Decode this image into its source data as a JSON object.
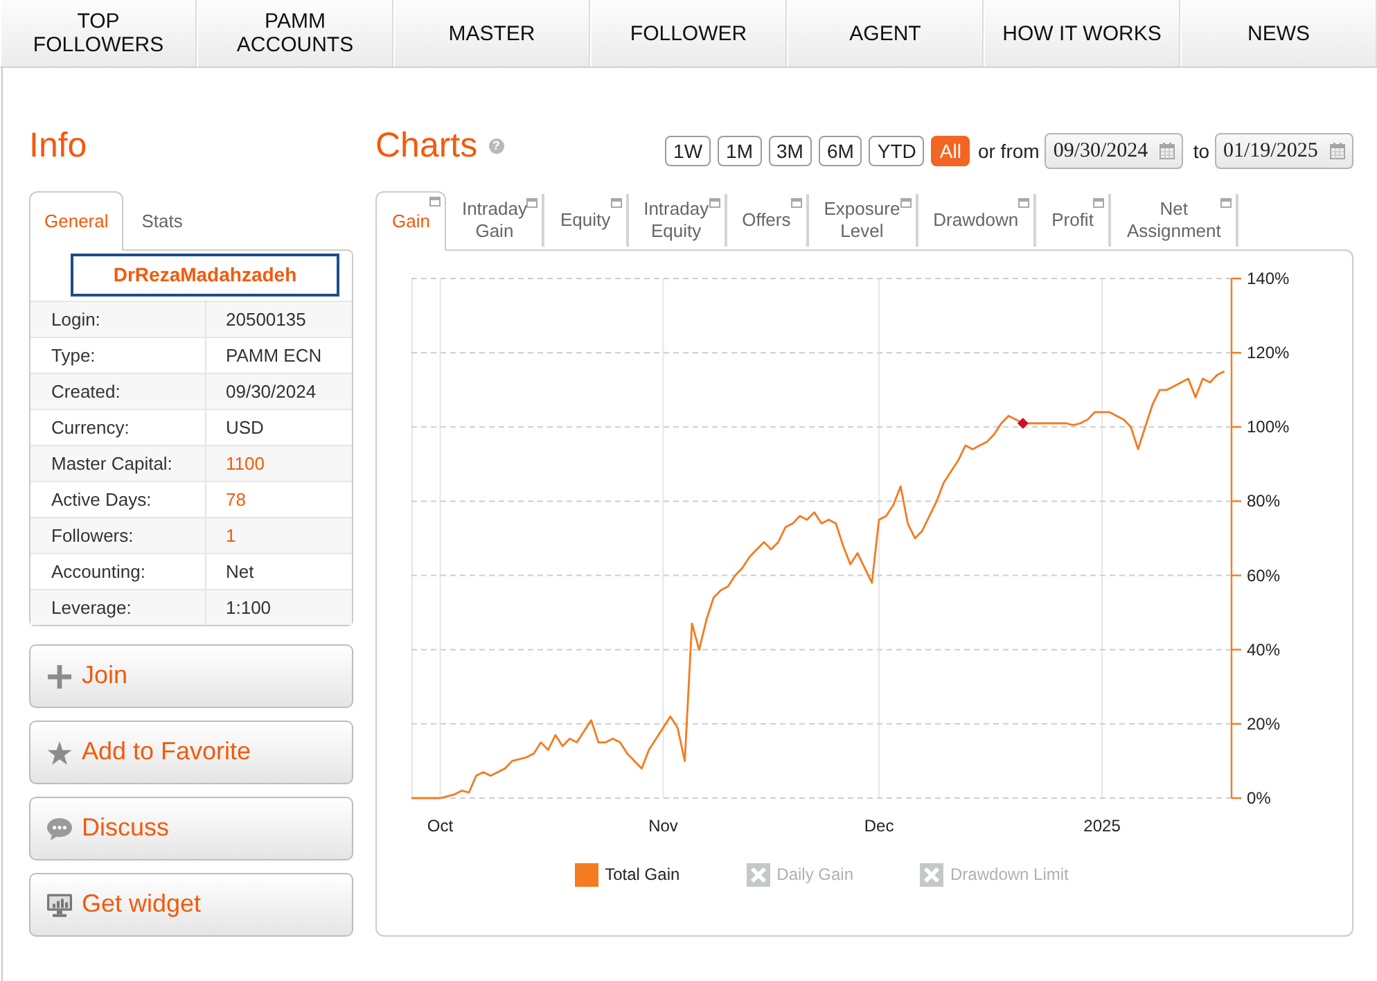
{
  "nav": [
    "TOP FOLLOWERS",
    "PAMM ACCOUNTS",
    "MASTER",
    "FOLLOWER",
    "AGENT",
    "HOW IT WORKS",
    "NEWS"
  ],
  "info": {
    "title": "Info",
    "tabs": [
      {
        "label": "General",
        "selected": true
      },
      {
        "label": "Stats",
        "selected": false
      }
    ],
    "account_name": "DrRezaMadahzadeh",
    "rows": [
      {
        "label": "Login:",
        "value": "20500135",
        "highlighted": false
      },
      {
        "label": "Type:",
        "value": "PAMM ECN",
        "highlighted": false
      },
      {
        "label": "Created:",
        "value": "09/30/2024",
        "highlighted": false
      },
      {
        "label": "Currency:",
        "value": "USD",
        "highlighted": false
      },
      {
        "label": "Master Capital:",
        "value": "1100",
        "highlighted": true
      },
      {
        "label": "Active Days:",
        "value": "78",
        "highlighted": true
      },
      {
        "label": "Followers:",
        "value": "1",
        "highlighted": true
      },
      {
        "label": "Accounting:",
        "value": "Net",
        "highlighted": false
      },
      {
        "label": "Leverage:",
        "value": "1:100",
        "highlighted": false
      }
    ],
    "actions": [
      {
        "kind": "plus",
        "label": "Join"
      },
      {
        "kind": "star",
        "label": "Add to Favorite"
      },
      {
        "kind": "chat",
        "label": "Discuss"
      },
      {
        "kind": "monitor",
        "label": "Get widget"
      }
    ]
  },
  "charts": {
    "title": "Charts",
    "help": "?",
    "ranges": [
      {
        "label": "1W",
        "selected": false
      },
      {
        "label": "1M",
        "selected": false
      },
      {
        "label": "3M",
        "selected": false
      },
      {
        "label": "6M",
        "selected": false
      },
      {
        "label": "YTD",
        "selected": false
      },
      {
        "label": "All",
        "selected": true
      }
    ],
    "from_label": "or from",
    "date_from": {
      "value": "09/30/2024"
    },
    "to_label": "to",
    "date_to": {
      "value": "01/19/2025"
    },
    "tabs": [
      {
        "label": "Gain",
        "selected": true
      },
      {
        "label": "Intraday Gain",
        "selected": false
      },
      {
        "label": "Equity",
        "selected": false
      },
      {
        "label": "Intraday Equity",
        "selected": false
      },
      {
        "label": "Offers",
        "selected": false
      },
      {
        "label": "Exposure Level",
        "selected": false
      },
      {
        "label": "Drawdown",
        "selected": false
      },
      {
        "label": "Profit",
        "selected": false
      },
      {
        "label": "Net Assignment",
        "selected": false
      }
    ],
    "chart_data": {
      "type": "line",
      "grid": true,
      "ylim": [
        0,
        140
      ],
      "yticks": [
        {
          "value": 0,
          "label": "0%"
        },
        {
          "value": 20,
          "label": "20%"
        },
        {
          "value": 40,
          "label": "40%"
        },
        {
          "value": 60,
          "label": "60%"
        },
        {
          "value": 80,
          "label": "80%"
        },
        {
          "value": 100,
          "label": "100%"
        },
        {
          "value": 120,
          "label": "120%"
        },
        {
          "value": 140,
          "label": "140%"
        }
      ],
      "categories": [
        null,
        null,
        null,
        null,
        "Oct",
        null,
        null,
        null,
        null,
        null,
        null,
        null,
        null,
        null,
        null,
        null,
        null,
        null,
        null,
        null,
        null,
        null,
        null,
        null,
        null,
        null,
        null,
        null,
        null,
        null,
        null,
        null,
        null,
        null,
        null,
        "Nov",
        null,
        null,
        null,
        null,
        null,
        null,
        null,
        null,
        null,
        null,
        null,
        null,
        null,
        null,
        null,
        null,
        null,
        null,
        null,
        null,
        null,
        null,
        null,
        null,
        null,
        null,
        null,
        null,
        null,
        "Dec",
        null,
        null,
        null,
        null,
        null,
        null,
        null,
        null,
        null,
        null,
        null,
        null,
        null,
        null,
        null,
        null,
        null,
        null,
        null,
        null,
        null,
        null,
        null,
        null,
        null,
        null,
        null,
        null,
        null,
        null,
        "2025",
        null,
        null,
        null,
        null,
        null,
        null,
        null,
        null,
        null,
        null,
        null,
        null,
        null,
        null,
        null,
        null,
        null
      ],
      "series": [
        {
          "name": "Total Gain",
          "color": "#f47b20",
          "values": [
            0,
            0,
            0,
            0,
            0,
            0.5,
            1,
            2,
            1.5,
            6,
            7,
            6,
            7,
            8,
            10,
            10.5,
            11,
            12,
            15,
            13,
            17,
            14,
            16,
            15,
            18,
            21,
            15,
            15,
            16,
            15,
            12,
            10,
            8,
            13,
            16,
            19,
            22,
            19,
            10,
            47,
            40,
            48,
            54,
            56,
            57,
            60,
            62,
            65,
            67,
            69,
            67,
            69,
            73,
            74,
            76,
            75,
            77,
            74,
            75,
            74,
            68,
            63,
            66,
            62,
            58,
            75,
            76,
            79,
            84,
            74,
            70,
            72,
            76,
            80,
            85,
            88,
            91,
            95,
            94,
            95,
            96,
            98,
            101,
            103,
            102,
            101,
            101,
            101,
            101,
            101,
            101,
            101,
            100.5,
            101,
            102,
            104,
            104,
            104,
            103,
            102,
            100,
            94,
            100,
            106,
            110,
            110,
            111,
            112,
            113,
            108,
            113,
            112,
            114,
            115
          ]
        },
        {
          "name": "Daily Gain",
          "values": [
            null,
            null,
            null,
            null,
            null,
            null,
            null,
            null,
            null,
            null,
            null,
            null,
            null,
            null,
            null,
            null,
            null,
            null,
            null,
            null,
            null,
            null,
            null,
            null,
            null,
            null,
            null,
            null,
            null,
            null,
            null,
            null,
            null,
            null,
            null,
            null,
            null,
            null,
            null,
            null,
            null,
            null,
            null,
            null,
            null,
            null,
            null,
            null,
            null,
            null,
            null,
            null,
            null,
            null,
            null,
            null,
            null,
            null,
            null,
            null,
            null,
            null,
            null,
            null,
            null,
            null,
            null,
            null,
            null,
            null,
            null,
            null,
            null,
            null,
            null,
            null,
            null,
            null,
            null,
            null,
            null,
            null,
            null,
            null,
            null,
            null,
            null,
            null,
            null,
            null,
            null,
            null,
            null,
            null,
            null,
            null,
            null,
            null,
            null,
            null,
            null,
            null,
            null,
            null,
            null,
            null,
            null,
            null,
            null,
            null,
            null,
            null,
            null,
            null
          ]
        },
        {
          "name": "Drawdown Limit",
          "values": [
            null,
            null,
            null,
            null,
            null,
            null,
            null,
            null,
            null,
            null,
            null,
            null,
            null,
            null,
            null,
            null,
            null,
            null,
            null,
            null,
            null,
            null,
            null,
            null,
            null,
            null,
            null,
            null,
            null,
            null,
            null,
            null,
            null,
            null,
            null,
            null,
            null,
            null,
            null,
            null,
            null,
            null,
            null,
            null,
            null,
            null,
            null,
            null,
            null,
            null,
            null,
            null,
            null,
            null,
            null,
            null,
            null,
            null,
            null,
            null,
            null,
            null,
            null,
            null,
            null,
            null,
            null,
            null,
            null,
            null,
            null,
            null,
            null,
            null,
            null,
            null,
            null,
            null,
            null,
            null,
            null,
            null,
            null,
            null,
            null,
            null,
            null,
            null,
            null,
            null,
            null,
            null,
            null,
            null,
            null,
            null,
            null,
            null,
            null,
            null,
            null,
            null,
            null,
            null,
            null,
            null,
            null,
            null,
            null,
            null,
            null,
            null,
            null,
            null
          ]
        },
        {
          "color": "#c8102e",
          "marker": "diamond",
          "values": [
            null,
            null,
            null,
            null,
            null,
            null,
            null,
            null,
            null,
            null,
            null,
            null,
            null,
            null,
            null,
            null,
            null,
            null,
            null,
            null,
            null,
            null,
            null,
            null,
            null,
            null,
            null,
            null,
            null,
            null,
            null,
            null,
            null,
            null,
            null,
            null,
            null,
            null,
            null,
            null,
            null,
            null,
            null,
            null,
            null,
            null,
            null,
            null,
            null,
            null,
            null,
            null,
            null,
            null,
            null,
            null,
            null,
            null,
            null,
            null,
            null,
            null,
            null,
            null,
            null,
            null,
            null,
            null,
            null,
            null,
            null,
            null,
            null,
            null,
            null,
            null,
            null,
            null,
            null,
            null,
            null,
            null,
            null,
            null,
            null,
            101,
            null,
            null,
            null,
            null,
            null,
            null,
            null,
            null,
            null,
            null,
            null,
            null,
            null,
            null,
            null,
            null,
            null,
            null,
            null,
            null,
            null,
            null,
            null,
            null,
            null,
            null,
            null,
            null
          ]
        }
      ]
    },
    "legend": [
      {
        "visible": true
      },
      {
        "visible": false
      },
      {
        "visible": false
      }
    ]
  }
}
